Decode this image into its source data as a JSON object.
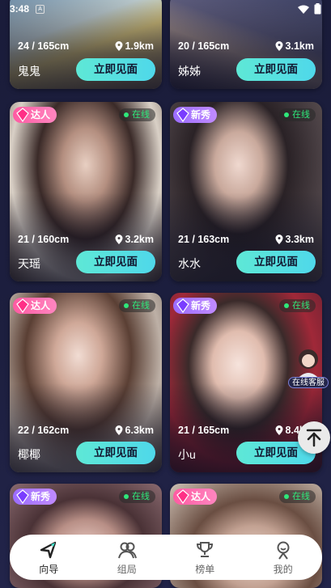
{
  "status_bar": {
    "time": "3:48",
    "notification": "A"
  },
  "cards": [
    {
      "stats": "24 / 165cm",
      "distance": "1.9km",
      "name": "鬼鬼",
      "badge": "",
      "online": ""
    },
    {
      "stats": "20 / 165cm",
      "distance": "3.1km",
      "name": "姊姊",
      "badge": "",
      "online": ""
    },
    {
      "stats": "21 / 160cm",
      "distance": "3.2km",
      "name": "天瑶",
      "badge": "达人",
      "online": "在线"
    },
    {
      "stats": "21 / 163cm",
      "distance": "3.3km",
      "name": "水水",
      "badge": "新秀",
      "online": "在线"
    },
    {
      "stats": "22 / 162cm",
      "distance": "6.3km",
      "name": "椰椰",
      "badge": "达人",
      "online": "在线"
    },
    {
      "stats": "21 / 165cm",
      "distance": "8.4km",
      "name": "小u",
      "badge": "新秀",
      "online": "在线"
    },
    {
      "stats": "",
      "distance": "",
      "name": "",
      "badge": "新秀",
      "online": "在线"
    },
    {
      "stats": "",
      "distance": "",
      "name": "",
      "badge": "达人",
      "online": "在线"
    }
  ],
  "meet_button_label": "立即见面",
  "floating_service_label": "在线客服",
  "tabs": [
    {
      "label": "向导",
      "icon": "navigate-icon",
      "active": true
    },
    {
      "label": "组局",
      "icon": "group-icon",
      "active": false
    },
    {
      "label": "榜单",
      "icon": "trophy-icon",
      "active": false
    },
    {
      "label": "我的",
      "icon": "profile-icon",
      "active": false
    }
  ],
  "colors": {
    "accent": "#5ee8d6",
    "online": "#2ee87a",
    "daren_badge": "#ff5aa2",
    "xinxiu_badge": "#9b6cff",
    "background": "#1a1c3a"
  }
}
